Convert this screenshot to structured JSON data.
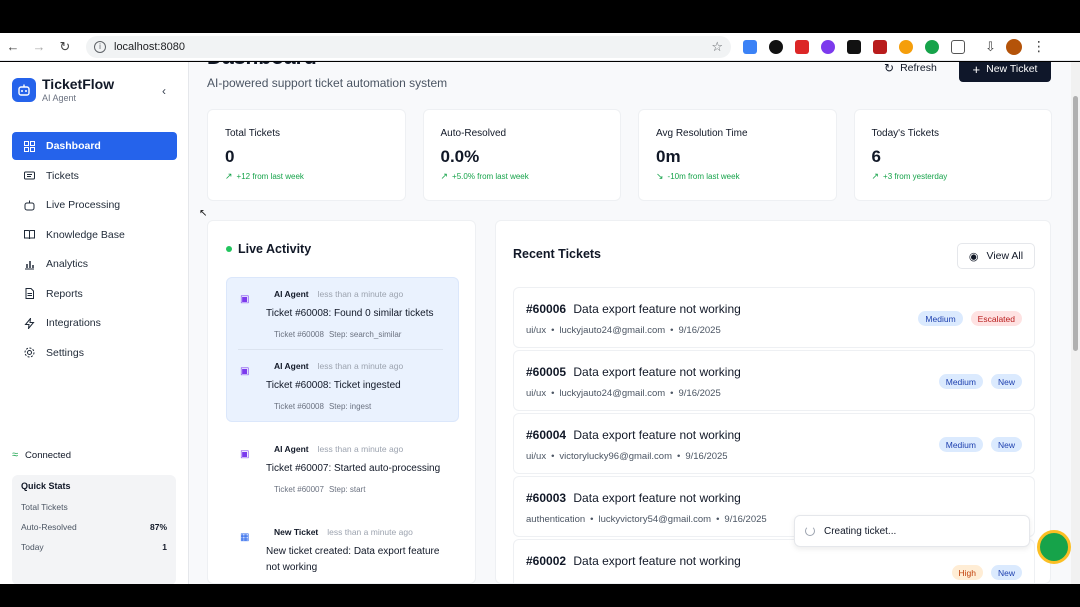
{
  "browser": {
    "url": "localhost:8080"
  },
  "app": {
    "name": "TicketFlow",
    "subtitle": "AI Agent"
  },
  "sidebar": {
    "items": [
      {
        "label": "Dashboard",
        "icon": "grid-icon",
        "active": true
      },
      {
        "label": "Tickets",
        "icon": "ticket-icon"
      },
      {
        "label": "Live Processing",
        "icon": "bot-icon"
      },
      {
        "label": "Knowledge Base",
        "icon": "book-icon"
      },
      {
        "label": "Analytics",
        "icon": "chart-icon"
      },
      {
        "label": "Reports",
        "icon": "file-icon"
      },
      {
        "label": "Integrations",
        "icon": "bolt-icon"
      },
      {
        "label": "Settings",
        "icon": "gear-icon"
      }
    ],
    "connection": "Connected",
    "quick_stats": {
      "title": "Quick Stats",
      "rows": [
        {
          "label": "Total Tickets",
          "value": ""
        },
        {
          "label": "Auto-Resolved",
          "value": "87%"
        },
        {
          "label": "Today",
          "value": "1"
        }
      ]
    }
  },
  "header": {
    "title": "Dashboard",
    "subtitle": "AI-powered support ticket automation system",
    "refresh_label": "Refresh",
    "new_ticket_label": "New Ticket"
  },
  "stats": [
    {
      "label": "Total Tickets",
      "value": "0",
      "trend": "+12 from last week"
    },
    {
      "label": "Auto-Resolved",
      "value": "0.0%",
      "trend": "+5.0% from last week"
    },
    {
      "label": "Avg Resolution Time",
      "value": "0m",
      "trend": "-10m from last week"
    },
    {
      "label": "Today's Tickets",
      "value": "6",
      "trend": "+3 from yesterday"
    }
  ],
  "live_activity": {
    "title": "Live Activity",
    "items": [
      {
        "actor": "AI Agent",
        "time": "less than a minute ago",
        "message": "Ticket #60008: Found 0 similar tickets",
        "ticket": "Ticket #60008",
        "step": "Step: search_similar"
      },
      {
        "actor": "AI Agent",
        "time": "less than a minute ago",
        "message": "Ticket #60008: Ticket ingested",
        "ticket": "Ticket #60008",
        "step": "Step: ingest"
      },
      {
        "actor": "AI Agent",
        "time": "less than a minute ago",
        "message": "Ticket #60007: Started auto-processing",
        "ticket": "Ticket #60007",
        "step": "Step: start"
      },
      {
        "actor": "New Ticket",
        "time": "less than a minute ago",
        "message": "New ticket created: Data export feature not working"
      }
    ]
  },
  "recent_tickets": {
    "title": "Recent Tickets",
    "view_all_label": "View All",
    "items": [
      {
        "id": "#60006",
        "title": "Data export feature not working",
        "category": "ui/ux",
        "email": "luckyjauto24@gmail.com",
        "date": "9/16/2025",
        "priority": "Medium",
        "status": "Escalated"
      },
      {
        "id": "#60005",
        "title": "Data export feature not working",
        "category": "ui/ux",
        "email": "luckyjauto24@gmail.com",
        "date": "9/16/2025",
        "priority": "Medium",
        "status": "New"
      },
      {
        "id": "#60004",
        "title": "Data export feature not working",
        "category": "ui/ux",
        "email": "victorylucky96@gmail.com",
        "date": "9/16/2025",
        "priority": "Medium",
        "status": "New"
      },
      {
        "id": "#60003",
        "title": "Data export feature not working",
        "category": "authentication",
        "email": "luckyvictory54@gmail.com",
        "date": "9/16/2025",
        "priority": "",
        "status": ""
      },
      {
        "id": "#60002",
        "title": "Data export feature not working",
        "category": "",
        "email": "",
        "date": "",
        "priority": "High",
        "status": "New"
      }
    ]
  },
  "toast": {
    "message": "Creating ticket..."
  },
  "colors": {
    "accent": "#2563eb",
    "dark_button": "#0f172a",
    "positive": "#16a34a"
  }
}
